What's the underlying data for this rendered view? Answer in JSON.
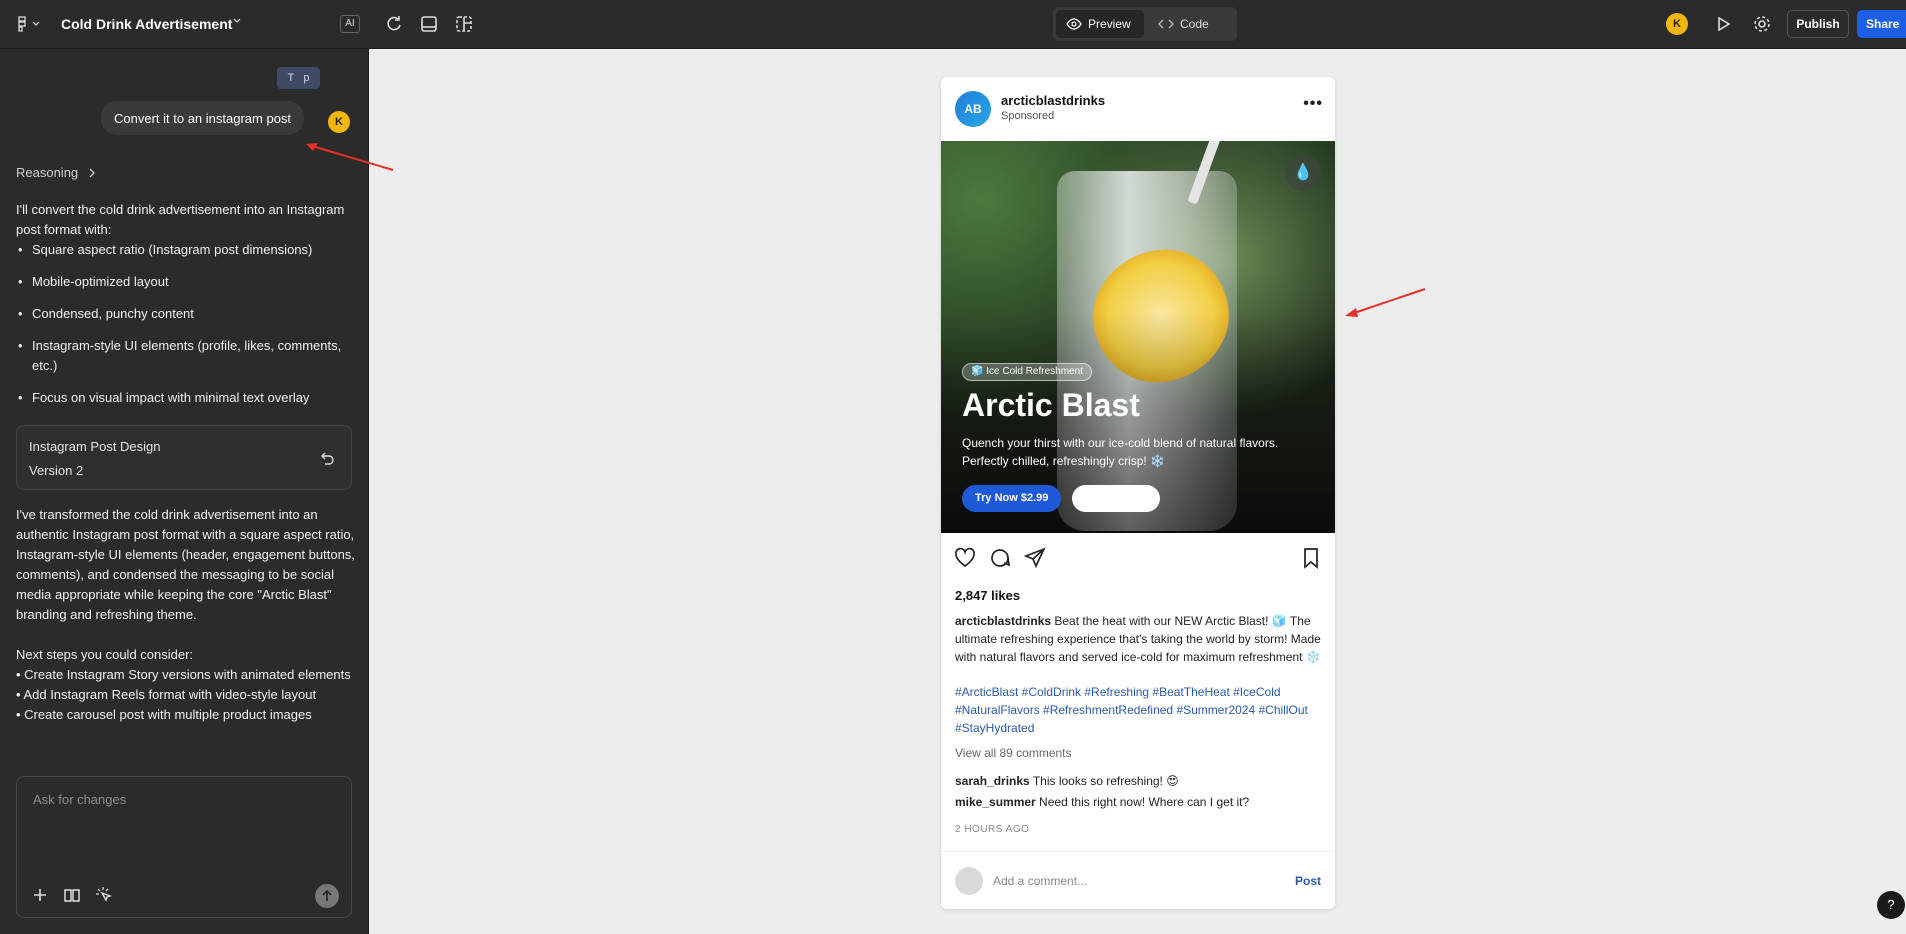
{
  "topbar": {
    "project_title": "Cold Drink Advertisement",
    "ai_label": "AI",
    "preview_label": "Preview",
    "code_label": "Code",
    "avatar_initial": "K",
    "publish_label": "Publish",
    "share_label": "Share"
  },
  "chat": {
    "chip_label_t": "T",
    "chip_label_p": "p",
    "user_message": "Convert it to an instagram post",
    "user_avatar": "K",
    "reasoning_label": "Reasoning",
    "assistant_intro": "I'll convert the cold drink advertisement into an Instagram post format with:",
    "bullets": [
      "Square aspect ratio (Instagram post dimensions)",
      "Mobile-optimized layout",
      "Condensed, punchy content",
      "Instagram-style UI elements (profile, likes, comments, etc.)",
      "Focus on visual impact with minimal text overlay"
    ],
    "version_card": {
      "title": "Instagram Post Design",
      "version": "Version 2"
    },
    "assistant_summary": "I've transformed the cold drink advertisement into an authentic Instagram post format with a square aspect ratio, Instagram-style UI elements (header, engagement buttons, comments), and condensed the messaging to be social media appropriate while keeping the core \"Arctic Blast\" branding and refreshing theme.",
    "next_steps_title": "Next steps you could consider:",
    "next_steps": [
      "• Create Instagram Story versions with animated elements",
      "• Add Instagram Reels format with video-style layout",
      "• Create carousel post with multiple product images"
    ],
    "composer_placeholder": "Ask for changes"
  },
  "post": {
    "avatar_initials": "AB",
    "username": "arcticblastdrinks",
    "sponsored": "Sponsored",
    "more": "•••",
    "badge": "🧊 Ice Cold Refreshment",
    "hero_title": "Arctic Blast",
    "hero_sub_line1": "Quench your thirst with our ice-cold blend of natural flavors.",
    "hero_sub_line2": "Perfectly chilled, refreshingly crisp! ❄️",
    "cta_label": "Try Now $2.99",
    "likes": "2,847 likes",
    "caption_user": "arcticblastdrinks",
    "caption_text": " Beat the heat with our NEW Arctic Blast! 🧊 The ultimate refreshing experience that's taking the world by storm! Made with natural flavors and served ice-cold for maximum refreshment ❄️",
    "hashtags": "#ArcticBlast #ColdDrink #Refreshing #BeatTheHeat #IceCold #NaturalFlavors #RefreshmentRedefined #Summer2024 #ChillOut #StayHydrated",
    "view_all": "View all 89 comments",
    "comments": [
      {
        "user": "sarah_drinks",
        "text": " This looks so refreshing! 😍"
      },
      {
        "user": "mike_summer",
        "text": " Need this right now! Where can I get it?"
      }
    ],
    "time": "2 HOURS AGO",
    "add_comment_placeholder": "Add a comment...",
    "post_label": "Post"
  },
  "help_label": "?",
  "colors": {
    "accent_blue": "#1d5ee7",
    "avatar_yellow": "#f2b70e",
    "panel_dark": "#2b2b2b",
    "hashtag_blue": "#2a5aa8",
    "annotation_red": "#e5312b"
  }
}
